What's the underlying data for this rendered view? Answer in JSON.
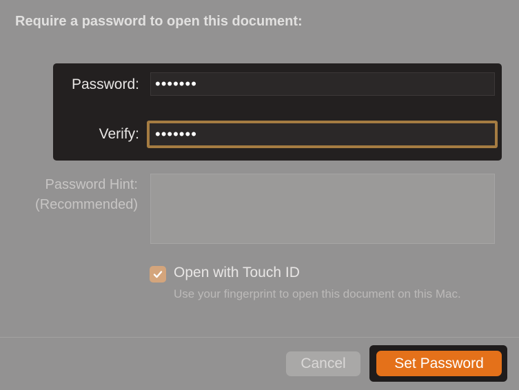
{
  "dialog": {
    "title": "Require a password to open this document:"
  },
  "password_field": {
    "label": "Password:",
    "value": "•••••••"
  },
  "verify_field": {
    "label": "Verify:",
    "value": "•••••••"
  },
  "hint_field": {
    "label_line1": "Password Hint:",
    "label_line2": "(Recommended)",
    "value": ""
  },
  "touch_id": {
    "checked": true,
    "label": "Open with Touch ID",
    "description": "Use your fingerprint to open this document on this Mac."
  },
  "buttons": {
    "cancel_label": "Cancel",
    "set_password_label": "Set Password"
  },
  "colors": {
    "accent": "#e4711a",
    "focus_ring": "#a57c42",
    "checkbox": "#d4a57c"
  },
  "icons": {
    "checkbox_mark": "checkmark-icon"
  }
}
